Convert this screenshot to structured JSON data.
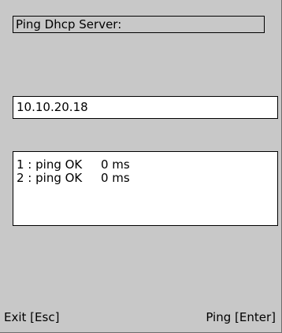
{
  "title": "Ping Dhcp Server:",
  "ip_field": {
    "value": "10.10.20.18"
  },
  "results": [
    {
      "label": "1 : ping OK",
      "time": "0 ms"
    },
    {
      "label": "2 : ping OK",
      "time": "0 ms"
    }
  ],
  "softkeys": {
    "exit_label": "Exit [Esc]",
    "ping_label": "Ping [Enter]"
  },
  "colors": {
    "background": "#c8c8c8",
    "field_background": "#ffffff",
    "border": "#000000"
  }
}
